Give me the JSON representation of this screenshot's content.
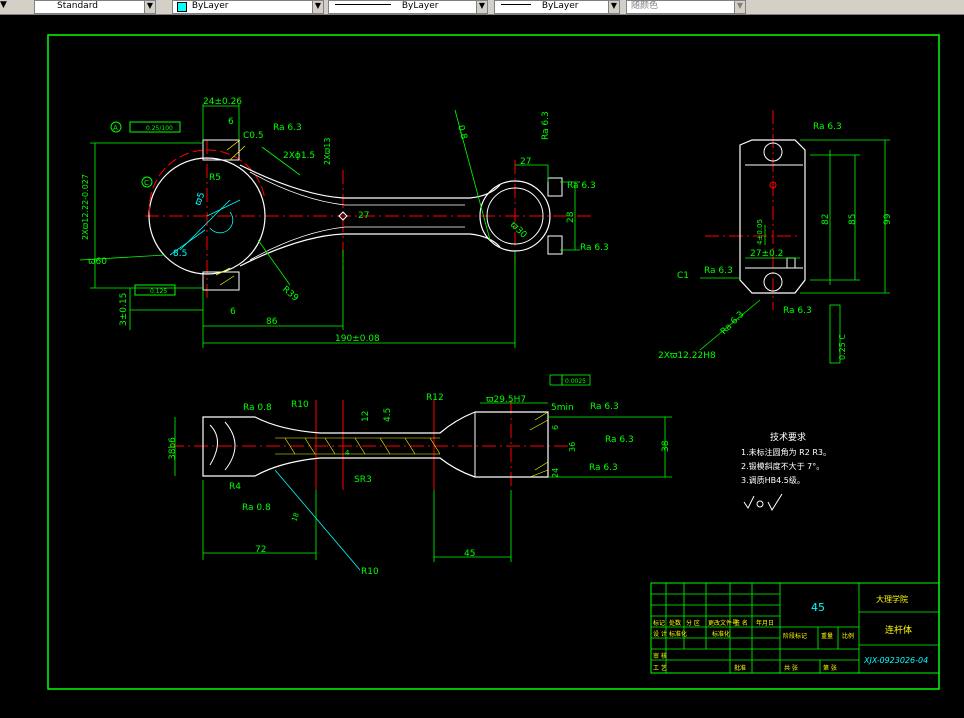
{
  "toolbar": {
    "textstyle": "Standard",
    "layer": "ByLayer",
    "linetype": "ByLayer",
    "lineweight": "ByLayer",
    "color": "随颜色"
  },
  "drawing": {
    "dims": {
      "d24": "24±0.26",
      "d6top": "6",
      "tol1": "0.25/100",
      "datumA": "A",
      "c05": "C0.5",
      "ra63a": "Ra 6.3",
      "hole2": "2Xϕ1.5",
      "d2x13": "2Xϖ13",
      "radius_r5": "R5",
      "dia12": "2Xϖ12.22-0.027",
      "d60": "ϖ60",
      "d85": "8.5",
      "d3": "3±0.15",
      "tol2": "0.125",
      "d6bot": "6",
      "d86": "86",
      "d190": "190±0.08",
      "r39": "R39",
      "d27": "27",
      "d27b": "27",
      "d28": "28",
      "d30": "ϖ30",
      "r63b": "Ra 6.3",
      "r63c": "Ra 6.3",
      "d08": "0.8",
      "d5": "ϖ5",
      "datumC": "C",
      "c1": "C1",
      "d82": "82",
      "d85b": "85",
      "d99": "99",
      "d27c": "27±0.2",
      "d4": "4±0.05",
      "ra63d": "Ra 6.3",
      "ra63e": "Ra 6.3",
      "ra63f": "Ra 6.3",
      "ra63g": "Ra 6.3",
      "hole12": "2Xϖ12.22H8",
      "tolC": "0.25 C",
      "d38": "38b6",
      "ra08a": "Ra 0.8",
      "r10a": "R10",
      "r12": "R12",
      "d295": "ϖ29.5H7",
      "d0025": "0.0025",
      "d5min": "5min",
      "d12": "12",
      "d45a": "4.5",
      "ra63h": "Ra 6.3",
      "ra63i": "Ra 6.3",
      "ra63j": "Ra 6.3",
      "d38b": "38",
      "d6": "6",
      "d36": "36",
      "d24b": "24",
      "r4": "R4",
      "ra08b": "Ra 0.8",
      "sr3": "SR3",
      "d72": "72",
      "d45": "45",
      "r10b": "R10",
      "d18": "18",
      "d4b": "4"
    },
    "notes": {
      "title": "技术要求",
      "line1": "1.未标注圆角为  R2 R3。",
      "line2": "2.锻模斜度不大于 7°。",
      "line3": "3.调质HB4.5级。"
    },
    "titleblock": {
      "material": "45",
      "school": "大理学院",
      "part_name": "连杆体",
      "drawing_no": "XJX-0923026-04",
      "h1": "标记",
      "h2": "处数",
      "h3": "分 区",
      "h4": "更改文件号",
      "h5": "签 名",
      "h6": "年月日",
      "h7": "设 计",
      "h8": "标准化",
      "h9": "阶段标记",
      "h10": "重量",
      "h11": "比例",
      "h12": "审 核",
      "h13": "工 艺",
      "h14": "批准",
      "h15": "共 张",
      "h16": "第 张"
    }
  }
}
